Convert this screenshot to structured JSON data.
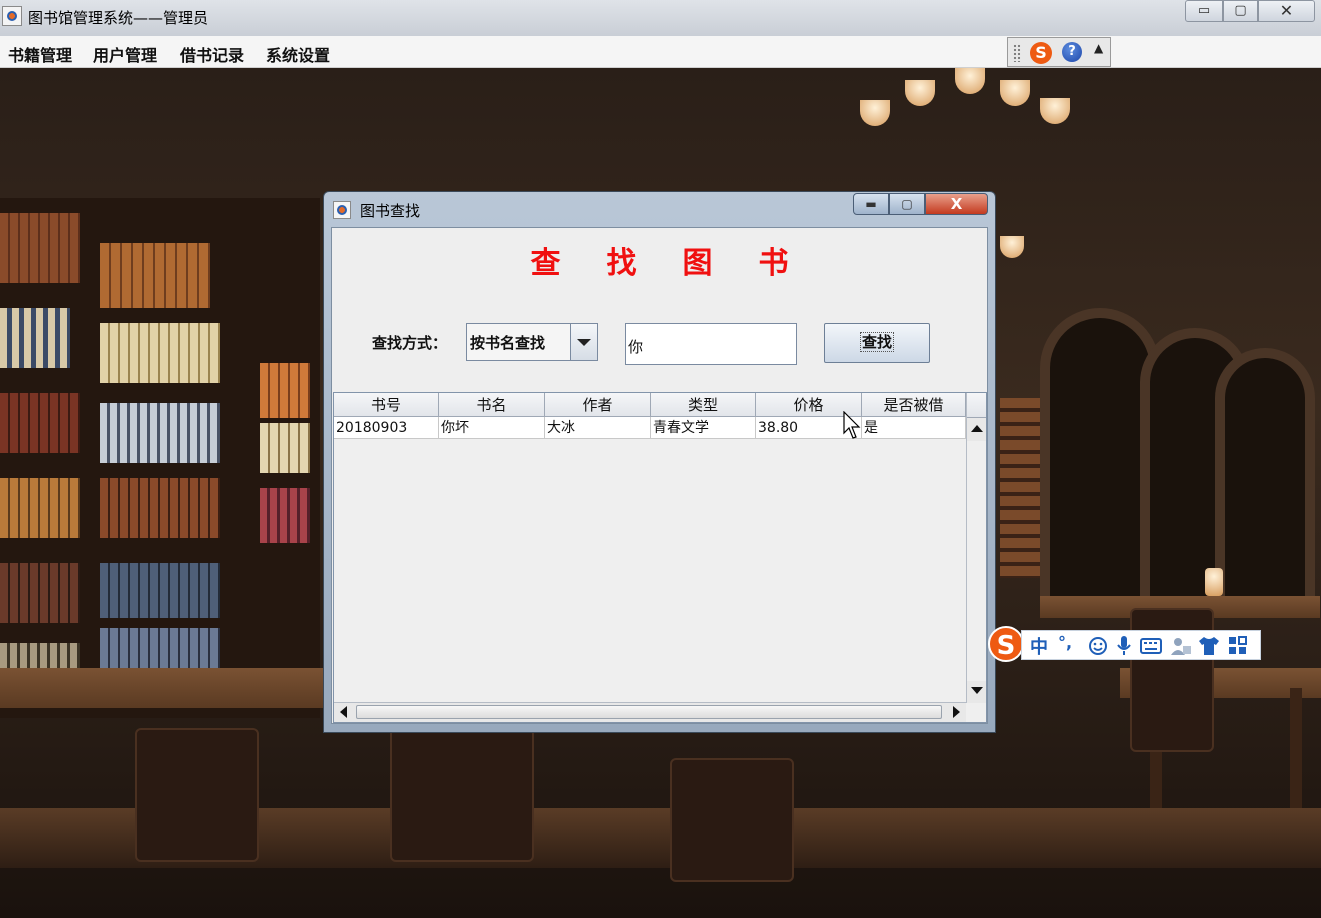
{
  "window": {
    "title": "图书馆管理系统——管理员",
    "min_glyph": "▭",
    "max_glyph": "▢",
    "close_glyph": "✕"
  },
  "menu": {
    "items": [
      {
        "label": "书籍管理"
      },
      {
        "label": "用户管理"
      },
      {
        "label": "借书记录"
      },
      {
        "label": "系统设置"
      }
    ]
  },
  "ime_toolbar": {
    "logo": "S",
    "help": "?",
    "more": "▲"
  },
  "dialog": {
    "title": "图书查找",
    "min_glyph": "▬",
    "max_glyph": "▢",
    "close_glyph": "X",
    "heading_chars": [
      "查",
      "找",
      "图",
      "书"
    ],
    "search_label": "查找方式：",
    "search_mode": "按书名查找",
    "keyword": "你",
    "search_button": "查找",
    "table": {
      "columns": [
        "书号",
        "书名",
        "作者",
        "类型",
        "价格",
        "是否被借"
      ],
      "rows": [
        [
          "20180903",
          "你坏",
          "大冰",
          "青春文学",
          "38.80",
          "是"
        ]
      ]
    }
  },
  "ime_bar": {
    "logo": "S",
    "chinese_mode": "中",
    "punct": "°,",
    "emoji_icon": "emoji-icon",
    "mic_icon": "microphone-icon",
    "keyboard_icon": "keyboard-icon",
    "user_icon": "user-icon",
    "skin_icon": "shirt-icon",
    "apps_icon": "grid-icon"
  },
  "colors": {
    "heading_red": "#f01010",
    "ime_orange": "#ee5a12",
    "ime_blue": "#1f5fb8"
  }
}
